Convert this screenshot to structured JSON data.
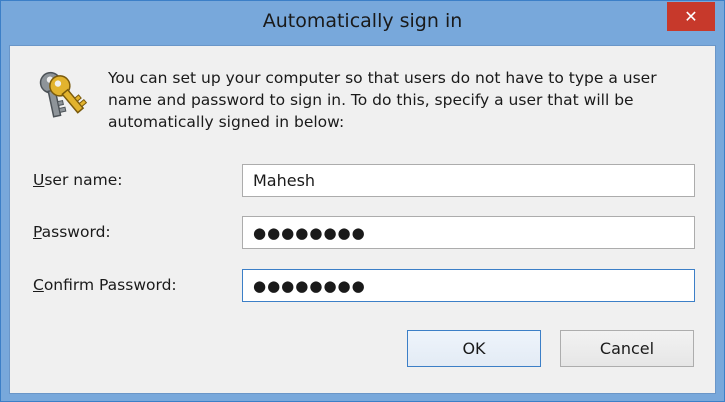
{
  "window": {
    "title": "Automatically sign in",
    "close_glyph": "✕"
  },
  "description": "You can set up your computer so that users do not have to type a user name and password to sign in. To do this, specify a user that will be automatically signed in below:",
  "icons": {
    "keys": "keys-icon",
    "close": "close-icon"
  },
  "fields": {
    "username": {
      "label_key": "U",
      "label_rest": "ser name:",
      "value": "Mahesh"
    },
    "password": {
      "label_key": "P",
      "label_rest": "assword:",
      "value": "●●●●●●●●"
    },
    "confirm": {
      "label_key": "C",
      "label_rest": "onfirm Password:",
      "value": "●●●●●●●●"
    }
  },
  "buttons": {
    "ok": "OK",
    "cancel": "Cancel"
  },
  "colors": {
    "frame": "#78a8db",
    "close": "#c7392b",
    "focus": "#3c7fc7"
  }
}
